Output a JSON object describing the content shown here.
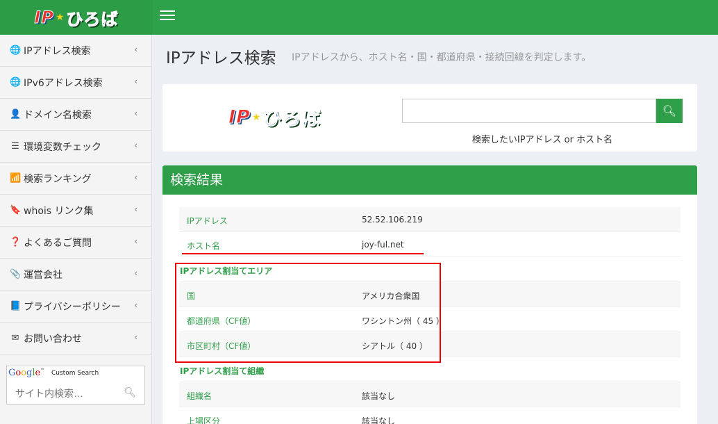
{
  "brand": {
    "ip": "IP",
    "star": "★",
    "hiroba": "ひろば"
  },
  "sidebar": {
    "items": [
      {
        "icon": "🌐",
        "label": "IPアドレス検索"
      },
      {
        "icon": "🌐",
        "label": "IPv6アドレス検索"
      },
      {
        "icon": "👤",
        "label": "ドメイン名検索"
      },
      {
        "icon": "☰",
        "label": "環境変数チェック"
      },
      {
        "icon": "📶",
        "label": "検索ランキング"
      },
      {
        "icon": "🔖",
        "label": "whois リンク集"
      },
      {
        "icon": "❓",
        "label": "よくあるご質問"
      },
      {
        "icon": "📎",
        "label": "運営会社"
      },
      {
        "icon": "📘",
        "label": "プライバシーポリシー"
      },
      {
        "icon": "✉",
        "label": "お問い合わせ"
      }
    ],
    "chevron": "‹",
    "google_search": {
      "logo": [
        "G",
        "o",
        "o",
        "g",
        "l",
        "e"
      ],
      "tm": "™",
      "custom": "Custom Search",
      "placeholder": "サイト内検索…"
    }
  },
  "page": {
    "title": "IPアドレス検索",
    "subtitle": "IPアドレスから、ホスト名・国・都道府県・接続回線を判定します。"
  },
  "search": {
    "hint": "検索したいIPアドレス or ホスト名",
    "value": ""
  },
  "results": {
    "heading": "検索結果",
    "rows": [
      {
        "key": "IPアドレス",
        "value": "52.52.106.219",
        "type": "row"
      },
      {
        "key": "ホスト名",
        "value": "joy-ful.net",
        "type": "row"
      },
      {
        "key": "IPアドレス割当てエリア",
        "value": "",
        "type": "section"
      },
      {
        "key": "国",
        "value": "アメリカ合衆国",
        "type": "row"
      },
      {
        "key": "都道府県（CF値）",
        "value": "ワシントン州（ 45 ）",
        "type": "row"
      },
      {
        "key": "市区町村（CF値）",
        "value": "シアトル（ 40 ）",
        "type": "row"
      },
      {
        "key": "IPアドレス割当て組織",
        "value": "",
        "type": "section"
      },
      {
        "key": "組織名",
        "value": "該当なし",
        "type": "row"
      },
      {
        "key": "上場区分",
        "value": "該当なし",
        "type": "row"
      }
    ]
  },
  "colors": {
    "brand_green": "#2e9e48",
    "highlight_red": "#e00000"
  }
}
